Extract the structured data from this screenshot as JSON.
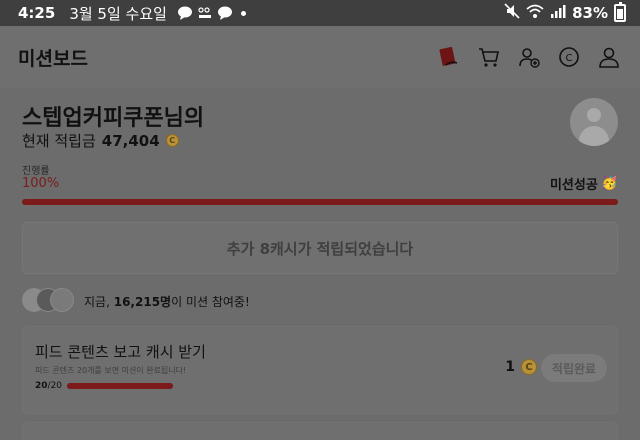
{
  "status_bar": {
    "time": "4:25",
    "date": "3월 5일 수요일",
    "battery": "83%"
  },
  "header": {
    "title": "미션보드",
    "icons": [
      "notebook-icon",
      "cart-icon",
      "user-add-icon",
      "coin-icon",
      "profile-icon"
    ]
  },
  "user": {
    "name": "스텝업커피쿠폰님의",
    "points_label": "현재 적립금",
    "points_value": "47,404",
    "coin_symbol": "C"
  },
  "progress": {
    "caption": "진행률",
    "percent_text": "100%",
    "percent_value": 100,
    "success_text": "미션성공",
    "success_emoji": "🥳"
  },
  "banner": {
    "text": "추가 8캐시가 적립되었습니다"
  },
  "participants": {
    "prefix": "지금,",
    "count": "16,215명",
    "suffix": "이 미션 참여중!"
  },
  "missions": [
    {
      "title": "피드 콘텐츠 보고 캐시 받기",
      "description": "피드 콘텐츠 20개를 보면 미션이 완료됩니다!",
      "done": "20",
      "total": "/20",
      "progress_value": 100,
      "reward": "1",
      "button_label": "적립완료"
    }
  ],
  "colors": {
    "accent": "#7d1a1a",
    "overlay": "#6c6c6c",
    "coin": "#b8923a"
  }
}
